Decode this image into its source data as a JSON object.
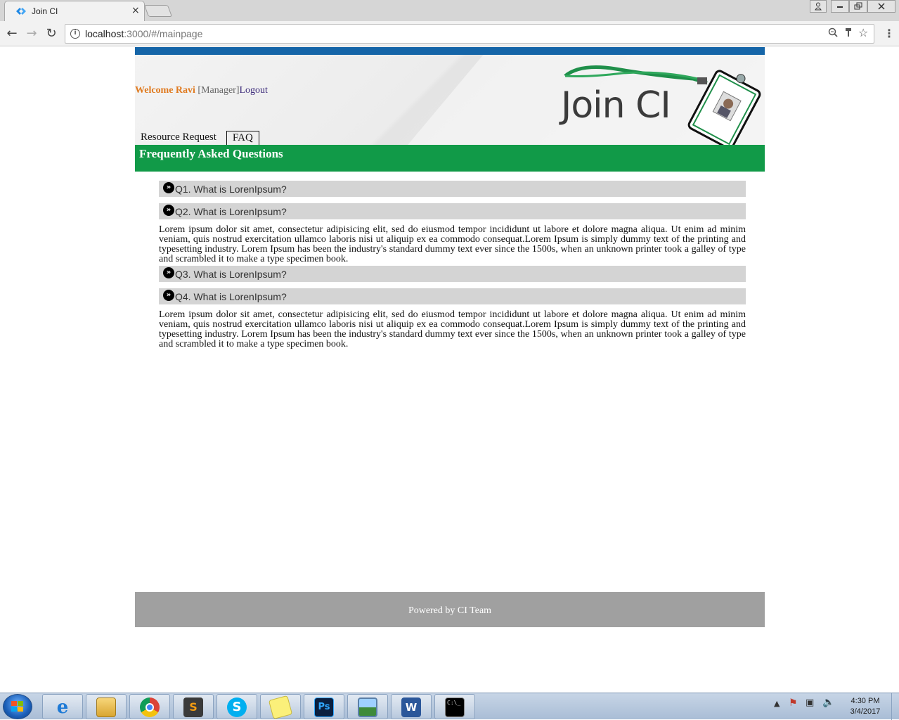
{
  "browser": {
    "tab_title": "Join CI",
    "tab_close": "×",
    "url_host": "localhost",
    "url_path": ":3000/#/mainpage",
    "window_buttons": [
      "user-icon",
      "minimize-icon",
      "restore-icon",
      "close-icon"
    ]
  },
  "header": {
    "welcome": "Welcome Ravi",
    "role": "[Manager]",
    "logout": "Logout",
    "logo_text": "Join CI",
    "topbar_color": "#1565a8"
  },
  "nav": {
    "tabs": [
      {
        "label": "Resource Request",
        "active": false
      },
      {
        "label": "FAQ",
        "active": true
      }
    ]
  },
  "banner": {
    "title": "Frequently Asked Questions",
    "color": "#119a48"
  },
  "faq": {
    "items": [
      {
        "question": "Q1. What is LorenIpsum?",
        "expanded": false,
        "answer": ""
      },
      {
        "question": "Q2. What is LorenIpsum?",
        "expanded": true,
        "answer": "Lorem ipsum dolor sit amet, consectetur adipisicing elit, sed do eiusmod tempor incididunt ut labore et dolore magna aliqua. Ut enim ad minim veniam, quis nostrud exercitation ullamco laboris nisi ut aliquip ex ea commodo consequat.Lorem Ipsum is simply dummy text of the printing and typesetting industry. Lorem Ipsum has been the industry's standard dummy text ever since the 1500s, when an unknown printer took a galley of type and scrambled it to make a type specimen book."
      },
      {
        "question": "Q3. What is LorenIpsum?",
        "expanded": false,
        "answer": ""
      },
      {
        "question": "Q4. What is LorenIpsum?",
        "expanded": true,
        "answer": "Lorem ipsum dolor sit amet, consectetur adipisicing elit, sed do eiusmod tempor incididunt ut labore et dolore magna aliqua. Ut enim ad minim veniam, quis nostrud exercitation ullamco laboris nisi ut aliquip ex ea commodo consequat.Lorem Ipsum is simply dummy text of the printing and typesetting industry. Lorem Ipsum has been the industry's standard dummy text ever since the 1500s, when an unknown printer took a galley of type and scrambled it to make a type specimen book."
      }
    ]
  },
  "footer": {
    "text": "Powered by CI Team"
  },
  "taskbar": {
    "apps": [
      "internet-explorer-icon",
      "file-explorer-icon",
      "chrome-icon",
      "sublime-text-icon",
      "skype-icon",
      "sticky-notes-icon",
      "photoshop-icon",
      "photo-viewer-icon",
      "word-icon",
      "command-prompt-icon"
    ],
    "clock_time": "4:30 PM",
    "clock_date": "3/4/2017"
  }
}
